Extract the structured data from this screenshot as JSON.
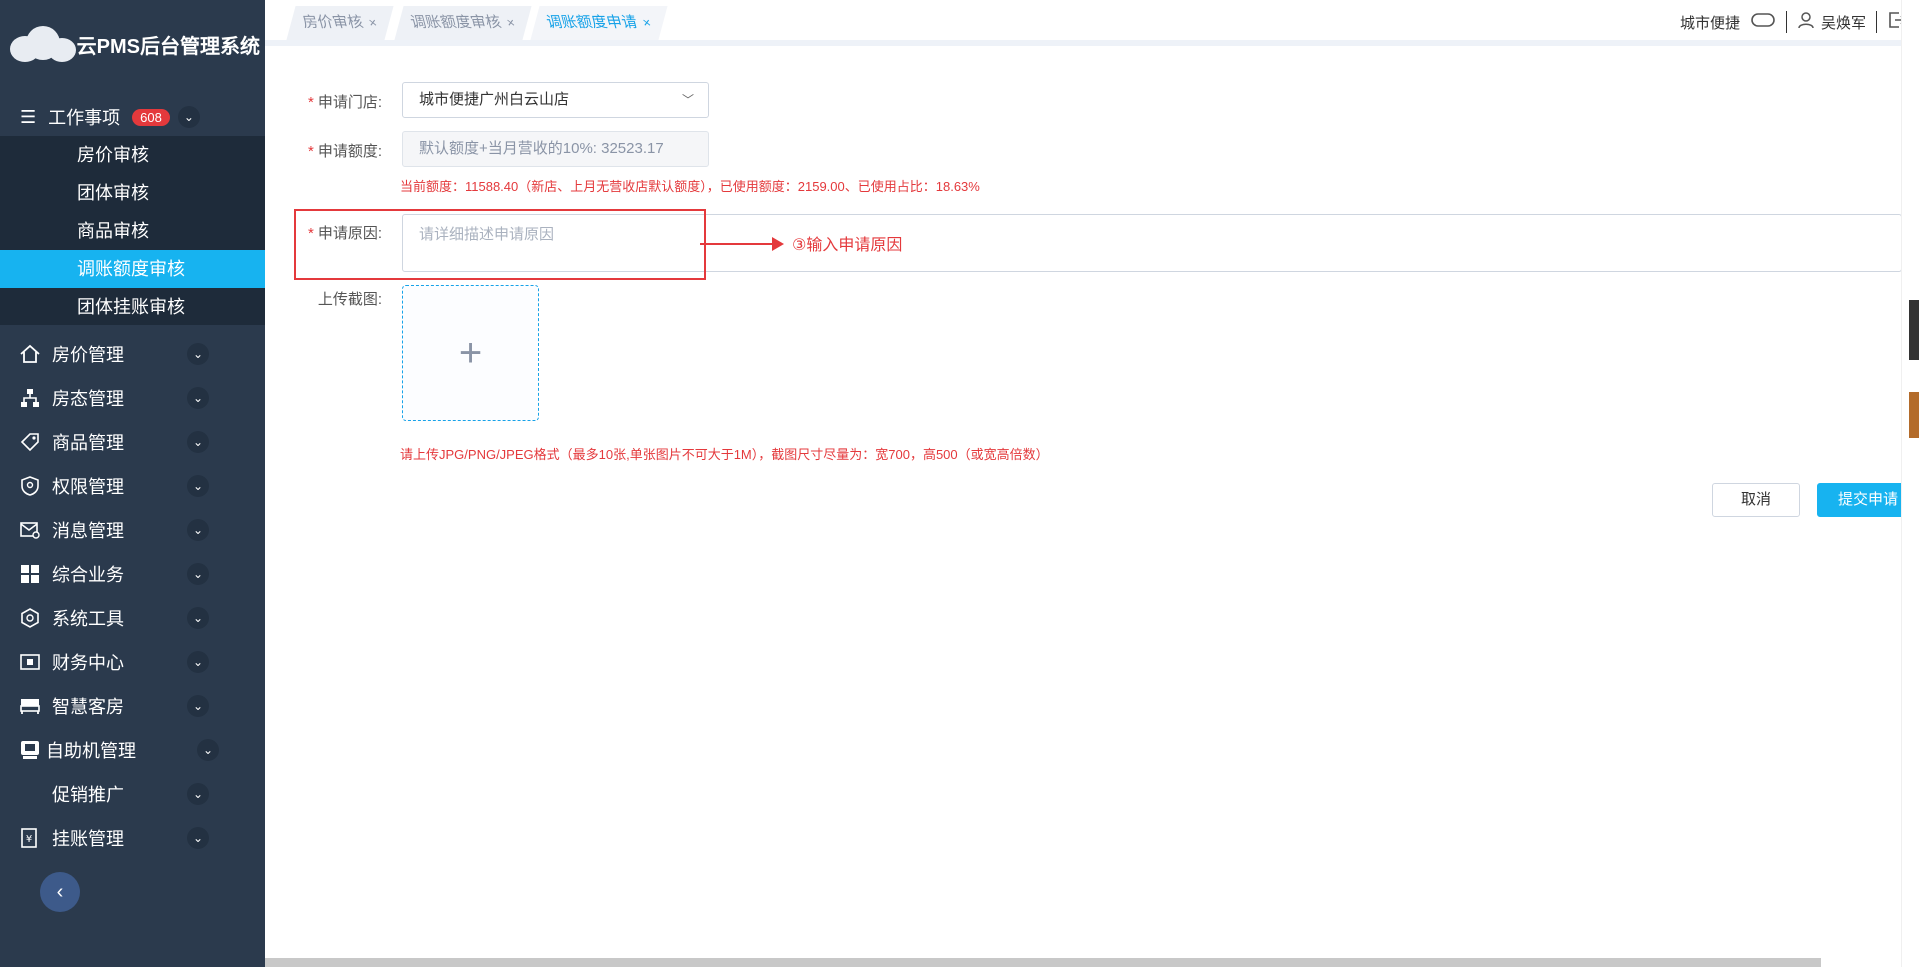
{
  "app": {
    "title": "云PMS后台管理系统"
  },
  "sidebar": {
    "work_items": {
      "label": "工作事项",
      "badge": "608"
    },
    "sub_items": [
      {
        "label": "房价审核",
        "active": false
      },
      {
        "label": "团体审核",
        "active": false
      },
      {
        "label": "商品审核",
        "active": false
      },
      {
        "label": "调账额度审核",
        "active": true
      },
      {
        "label": "团体挂账审核",
        "active": false
      }
    ],
    "menu": [
      {
        "label": "房价管理",
        "icon": "house-icon"
      },
      {
        "label": "房态管理",
        "icon": "sitemap-icon"
      },
      {
        "label": "商品管理",
        "icon": "tag-icon"
      },
      {
        "label": "权限管理",
        "icon": "shield-icon"
      },
      {
        "label": "消息管理",
        "icon": "mail-icon"
      },
      {
        "label": "综合业务",
        "icon": "grid-icon"
      },
      {
        "label": "系统工具",
        "icon": "hexagon-icon"
      },
      {
        "label": "财务中心",
        "icon": "finance-icon"
      },
      {
        "label": "智慧客房",
        "icon": "bed-icon"
      },
      {
        "label": "自助机管理",
        "icon": "kiosk-icon"
      },
      {
        "label": "促销推广",
        "icon": ""
      },
      {
        "label": "挂账管理",
        "icon": "yen-icon"
      }
    ]
  },
  "tabs": [
    {
      "label": "房价审核",
      "active": false
    },
    {
      "label": "调账额度审核",
      "active": false
    },
    {
      "label": "调账额度申请",
      "active": true
    }
  ],
  "header": {
    "hotel": "城市便捷",
    "user": "吴焕军"
  },
  "form": {
    "store_label": "申请门店:",
    "store_value": "城市便捷广州白云山店",
    "amount_label": "申请额度:",
    "amount_value": "默认额度+当月营收的10%:  32523.17",
    "amount_hint": "当前额度：11588.40（新店、上月无营收店默认额度），已使用额度：2159.00、已使用占比：18.63%",
    "reason_label": "申请原因:",
    "reason_placeholder": "请详细描述申请原因",
    "upload_label": "上传截图:",
    "upload_hint": "请上传JPG/PNG/JPEG格式（最多10张,单张图片不可大于1M），截图尺寸尽量为：宽700，高500（或宽高倍数）",
    "annotation": "③输入申请原因",
    "cancel_label": "取消",
    "submit_label": "提交申请"
  },
  "colors": {
    "sidebar_bg": "#2b3a4d",
    "accent": "#17b3f0",
    "danger": "#e4393c"
  }
}
